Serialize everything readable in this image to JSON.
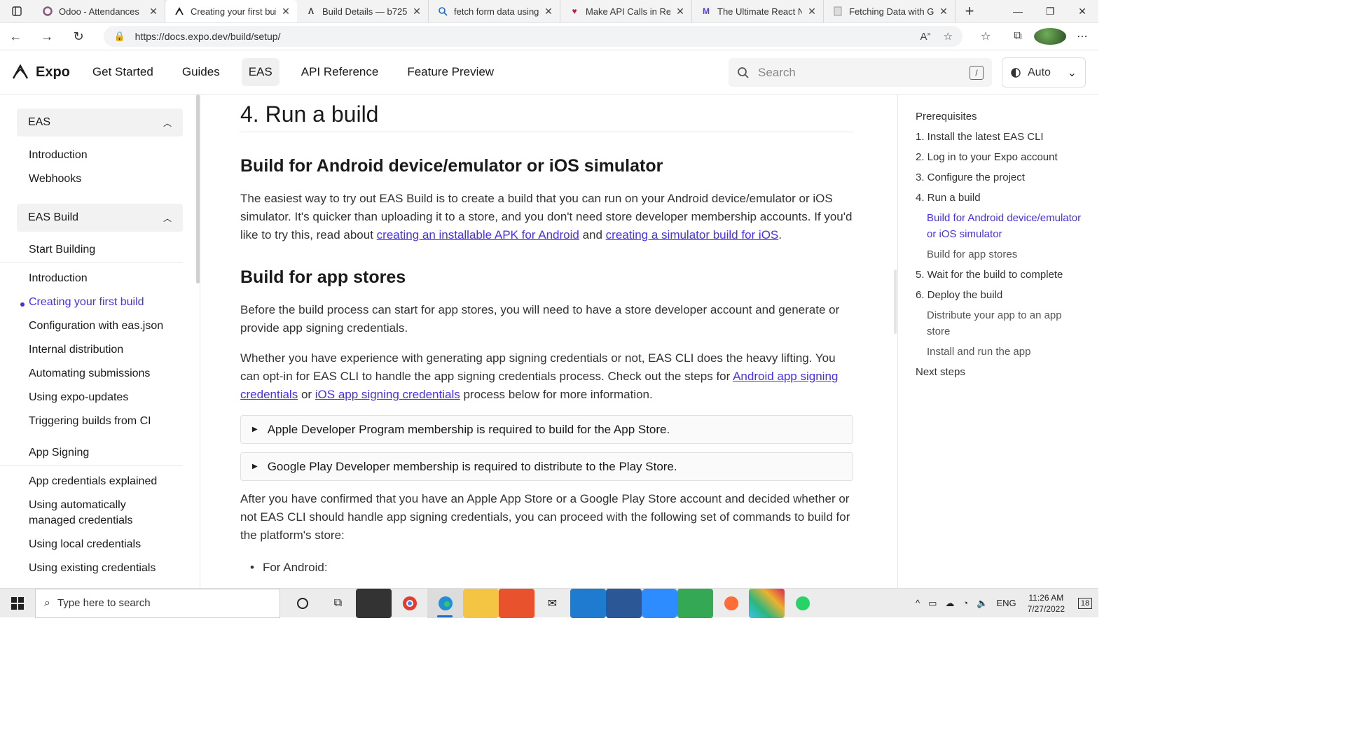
{
  "browser": {
    "tabs": [
      {
        "title": "Odoo - Attendances",
        "icon": "odoo-icon",
        "color": "#875a7b"
      },
      {
        "title": "Creating your first bui",
        "icon": "expo-icon",
        "color": "#1a1a1a"
      },
      {
        "title": "Build Details — b725",
        "icon": "expo-build-icon",
        "color": "#1a1a1a"
      },
      {
        "title": "fetch form data using",
        "icon": "search-icon",
        "color": "#1b6ac9"
      },
      {
        "title": "Make API Calls in Rea",
        "icon": "heart-icon",
        "color": "#c2185b"
      },
      {
        "title": "The Ultimate React Na",
        "icon": "react-native-icon",
        "color": "#5a3ec8"
      },
      {
        "title": "Fetching Data with Ge",
        "icon": "page-icon",
        "color": "#999999"
      }
    ],
    "url": "https://docs.expo.dev/build/setup/"
  },
  "header": {
    "brand": "Expo",
    "nav": [
      "Get Started",
      "Guides",
      "EAS",
      "API Reference",
      "Feature Preview"
    ],
    "active_nav": "EAS",
    "search_placeholder": "Search",
    "search_shortcut": "/",
    "theme_label": "Auto"
  },
  "sidebar": {
    "sections": [
      {
        "title": "EAS",
        "items": [
          "Introduction",
          "Webhooks"
        ]
      },
      {
        "title": "EAS Build"
      }
    ],
    "group_start": "Start Building",
    "build_items": [
      "Introduction",
      "Creating your first build",
      "Configuration with eas.json",
      "Internal distribution",
      "Automating submissions",
      "Using expo-updates",
      "Triggering builds from CI"
    ],
    "active_item": "Creating your first build",
    "group_signing": "App Signing",
    "signing_items": [
      "App credentials explained",
      "Using automatically managed credentials",
      "Using local credentials",
      "Using existing credentials"
    ]
  },
  "content": {
    "h1": "4. Run a build",
    "h2_simulator": "Build for Android device/emulator or iOS simulator",
    "p1_a": "The easiest way to try out EAS Build is to create a build that you can run on your Android device/emulator or iOS simulator. It's quicker than uploading it to a store, and you don't need store developer membership accounts. If you'd like to try this, read about ",
    "p1_link1": "creating an installable APK for Android",
    "p1_b": " and ",
    "p1_link2": "creating a simulator build for iOS",
    "p1_c": ".",
    "h2_stores": "Build for app stores",
    "p2": "Before the build process can start for app stores, you will need to have a store developer account and generate or provide app signing credentials.",
    "p3_a": "Whether you have experience with generating app signing credentials or not, EAS CLI does the heavy lifting. You can opt-in for EAS CLI to handle the app signing credentials process. Check out the steps for ",
    "p3_link1": "Android app signing credentials",
    "p3_b": " or ",
    "p3_link2": "iOS app signing credentials",
    "p3_c": " process below for more information.",
    "details": [
      "Apple Developer Program membership is required to build for the App Store.",
      "Google Play Developer membership is required to distribute to the Play Store."
    ],
    "p4": "After you have confirmed that you have an Apple App Store or a Google Play Store account and decided whether or not EAS CLI should handle app signing credentials, you can proceed with the following set of commands to build for the platform's store:",
    "bullet1": "For Android:"
  },
  "toc": {
    "items": [
      {
        "label": "Prerequisites",
        "level": 0
      },
      {
        "label": "1. Install the latest EAS CLI",
        "level": 0
      },
      {
        "label": "2. Log in to your Expo account",
        "level": 0
      },
      {
        "label": "3. Configure the project",
        "level": 0
      },
      {
        "label": "4. Run a build",
        "level": 0
      },
      {
        "label": "Build for Android device/emulator or iOS simulator",
        "level": 1,
        "active": true
      },
      {
        "label": "Build for app stores",
        "level": 1
      },
      {
        "label": "5. Wait for the build to complete",
        "level": 0
      },
      {
        "label": "6. Deploy the build",
        "level": 0
      },
      {
        "label": "Distribute your app to an app store",
        "level": 1
      },
      {
        "label": "Install and run the app",
        "level": 1
      },
      {
        "label": "Next steps",
        "level": 0
      }
    ]
  },
  "taskbar": {
    "search_placeholder": "Type here to search",
    "lang": "ENG",
    "time": "11:26 AM",
    "date": "7/27/2022",
    "notifications": "18"
  },
  "colors": {
    "accent": "#4630eb",
    "link": "#4630eb"
  }
}
